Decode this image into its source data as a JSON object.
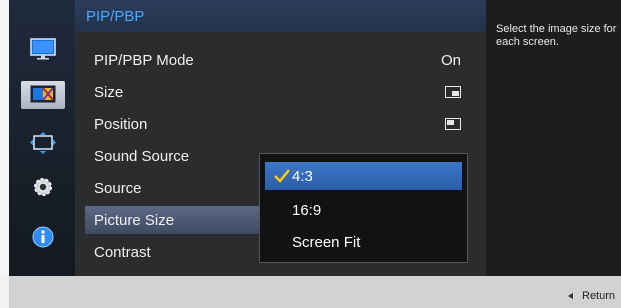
{
  "menu": {
    "title": "PIP/PBP",
    "rows": [
      {
        "label": "PIP/PBP Mode",
        "value": "On"
      },
      {
        "label": "Size",
        "icon": "size-icon"
      },
      {
        "label": "Position",
        "icon": "position-icon"
      },
      {
        "label": "Sound Source"
      },
      {
        "label": "Source"
      },
      {
        "label": "Picture Size",
        "selected": true
      },
      {
        "label": "Contrast"
      }
    ]
  },
  "dropdown": {
    "items": [
      {
        "label": "4:3",
        "selected": true
      },
      {
        "label": "16:9"
      },
      {
        "label": "Screen Fit"
      }
    ]
  },
  "help": {
    "text": "Select the image size for each screen."
  },
  "footer": {
    "return_label": "Return"
  },
  "sidebar_icons": [
    "picture-icon",
    "color-icon",
    "size-position-icon",
    "setup-icon",
    "info-icon"
  ],
  "colors": {
    "accent": "#4aa8ff",
    "selected_bg": "#2f64b2",
    "check": "#ffd200"
  }
}
